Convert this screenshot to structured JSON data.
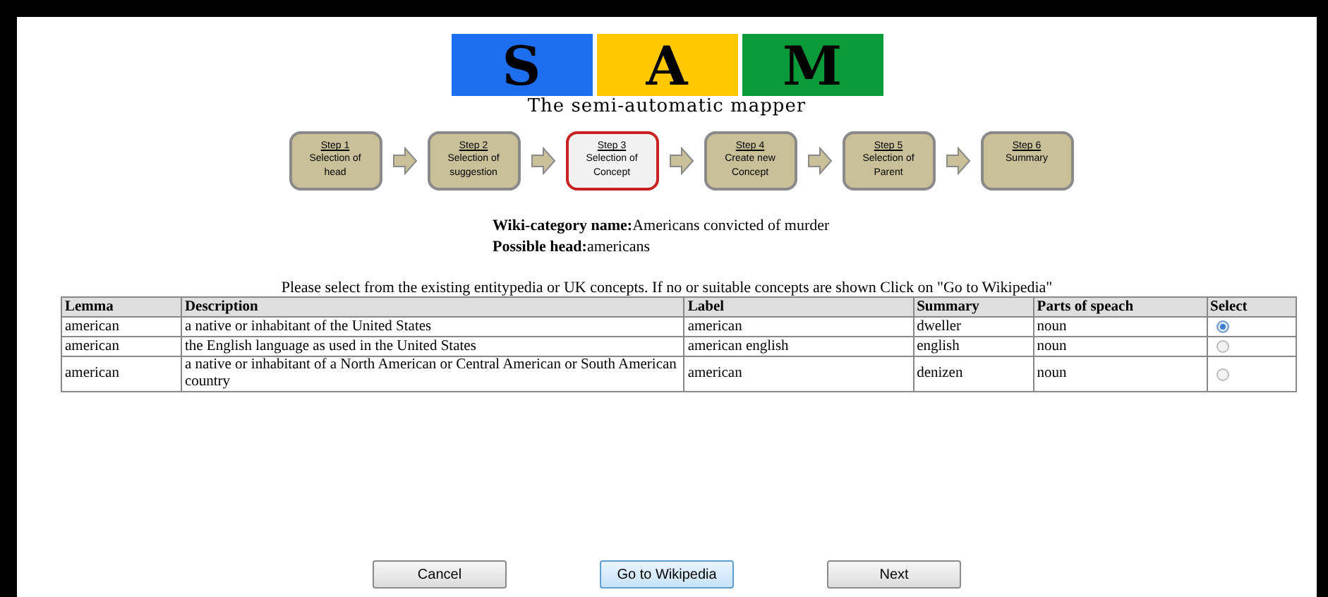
{
  "logo": {
    "letters": [
      {
        "text": "S",
        "color": "#1e6ff0"
      },
      {
        "text": "A",
        "color": "#ffc800"
      },
      {
        "text": "M",
        "color": "#0a9a3a"
      }
    ],
    "tagline": "The semi-automatic mapper"
  },
  "steps": [
    {
      "title": "Step 1",
      "label": "Selection of head",
      "selected": false
    },
    {
      "title": "Step 2",
      "label": "Selection of suggestion",
      "selected": false
    },
    {
      "title": "Step 3",
      "label": "Selection of Concept",
      "selected": true
    },
    {
      "title": "Step 4",
      "label": "Create new Concept",
      "selected": false
    },
    {
      "title": "Step 5",
      "label": "Selection of Parent",
      "selected": false
    },
    {
      "title": "Step 6",
      "label": "Summary",
      "selected": false
    }
  ],
  "info": [
    "**Wiki-category name:**Americans convicted of murder",
    "**Possible head:**americans"
  ],
  "instruction": "Please select from the existing entitypedia or UK concepts. If no or suitable concepts are shown Click on \"Go to Wikipedia\"",
  "table": {
    "columns": [
      "Lemma",
      "Description",
      "Label",
      "Summary",
      "Parts of speach",
      "Select"
    ],
    "rows": [
      {
        "lemma": "american",
        "description": "a native or inhabitant of the United States",
        "label": "american",
        "summary": "dweller",
        "pos": "noun",
        "selected": true
      },
      {
        "lemma": "american",
        "description": "the English language as used in the United States",
        "label": "american english",
        "summary": "english",
        "pos": "noun",
        "selected": false
      },
      {
        "lemma": "american",
        "description": "a native or inhabitant of a North American or Central American or South American country",
        "label": "american",
        "summary": "denizen",
        "pos": "noun",
        "selected": false
      }
    ]
  },
  "buttons": [
    {
      "label": "Cancel",
      "kind": "plain"
    },
    {
      "label": "Go to Wikipedia",
      "kind": "focused"
    },
    {
      "label": "Next",
      "kind": "plain"
    }
  ]
}
